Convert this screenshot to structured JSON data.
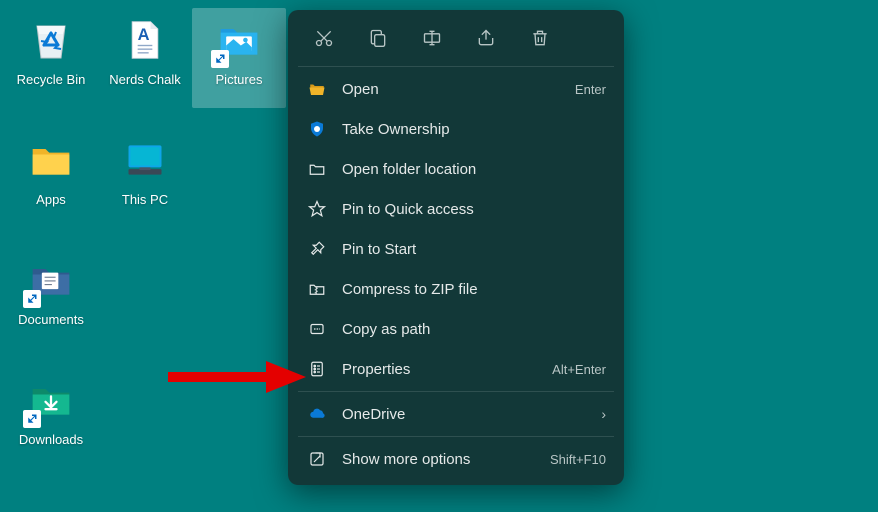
{
  "desktop": {
    "icons": [
      {
        "name": "recycle-bin",
        "label": "Recycle Bin"
      },
      {
        "name": "nerds-chalk",
        "label": "Nerds Chalk"
      },
      {
        "name": "pictures",
        "label": "Pictures",
        "selected": true
      },
      {
        "name": "apps",
        "label": "Apps"
      },
      {
        "name": "this-pc",
        "label": "This PC"
      },
      {
        "name": "blank",
        "label": ""
      },
      {
        "name": "documents",
        "label": "Documents"
      },
      {
        "name": "blank2",
        "label": ""
      },
      {
        "name": "blank3",
        "label": ""
      },
      {
        "name": "downloads",
        "label": "Downloads"
      }
    ]
  },
  "context_menu": {
    "top_actions": [
      {
        "name": "cut-icon",
        "title": "Cut"
      },
      {
        "name": "copy-icon",
        "title": "Copy"
      },
      {
        "name": "rename-icon",
        "title": "Rename"
      },
      {
        "name": "share-icon",
        "title": "Share"
      },
      {
        "name": "delete-icon",
        "title": "Delete"
      }
    ],
    "items": [
      {
        "icon": "folder-open-icon",
        "label": "Open",
        "shortcut": "Enter"
      },
      {
        "icon": "shield-icon",
        "label": "Take Ownership"
      },
      {
        "icon": "folder-location-icon",
        "label": "Open folder location"
      },
      {
        "icon": "star-icon",
        "label": "Pin to Quick access"
      },
      {
        "icon": "pin-icon",
        "label": "Pin to Start"
      },
      {
        "icon": "zip-icon",
        "label": "Compress to ZIP file"
      },
      {
        "icon": "copy-path-icon",
        "label": "Copy as path"
      },
      {
        "icon": "properties-icon",
        "label": "Properties",
        "shortcut": "Alt+Enter"
      }
    ],
    "onedrive": {
      "icon": "onedrive-icon",
      "label": "OneDrive",
      "submenu": true
    },
    "more": {
      "icon": "more-icon",
      "label": "Show more options",
      "shortcut": "Shift+F10"
    }
  }
}
